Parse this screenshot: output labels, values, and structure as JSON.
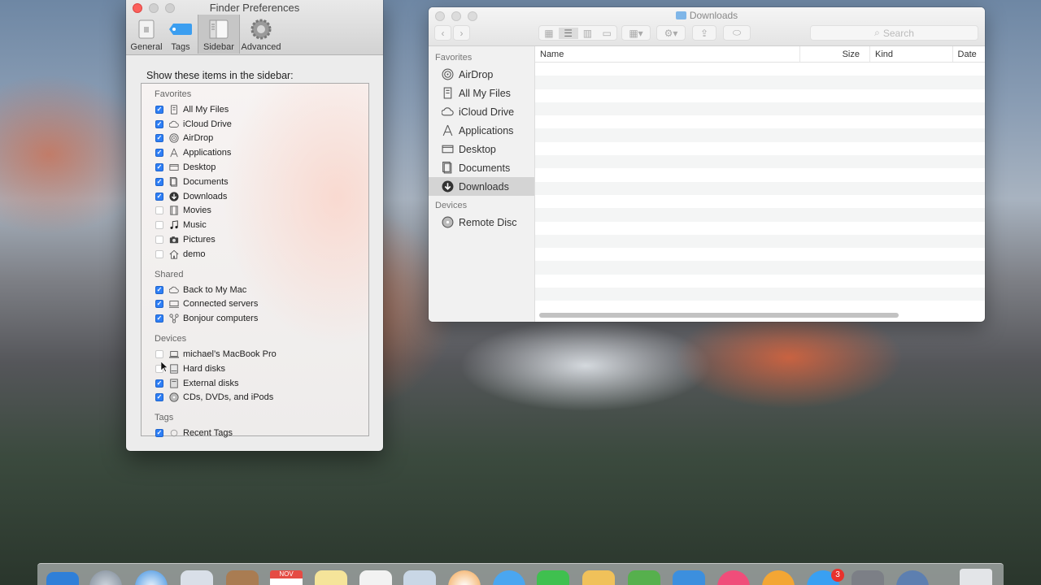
{
  "prefs": {
    "title": "Finder Preferences",
    "tabs": [
      {
        "label": "General",
        "icon": "general-icon"
      },
      {
        "label": "Tags",
        "icon": "tag-icon"
      },
      {
        "label": "Sidebar",
        "icon": "sidebar-icon",
        "active": true
      },
      {
        "label": "Advanced",
        "icon": "gear-icon"
      }
    ],
    "heading": "Show these items in the sidebar:",
    "sections": {
      "favorites": {
        "title": "Favorites",
        "items": [
          {
            "label": "All My Files",
            "checked": true,
            "icon": "all-files-icon"
          },
          {
            "label": "iCloud Drive",
            "checked": true,
            "icon": "cloud-icon"
          },
          {
            "label": "AirDrop",
            "checked": true,
            "icon": "airdrop-icon"
          },
          {
            "label": "Applications",
            "checked": true,
            "icon": "applications-icon"
          },
          {
            "label": "Desktop",
            "checked": true,
            "icon": "desktop-icon"
          },
          {
            "label": "Documents",
            "checked": true,
            "icon": "documents-icon"
          },
          {
            "label": "Downloads",
            "checked": true,
            "icon": "downloads-icon"
          },
          {
            "label": "Movies",
            "checked": false,
            "icon": "movies-icon"
          },
          {
            "label": "Music",
            "checked": false,
            "icon": "music-icon"
          },
          {
            "label": "Pictures",
            "checked": false,
            "icon": "camera-icon"
          },
          {
            "label": "demo",
            "checked": false,
            "icon": "home-icon"
          }
        ]
      },
      "shared": {
        "title": "Shared",
        "items": [
          {
            "label": "Back to My Mac",
            "checked": true,
            "icon": "cloud-icon"
          },
          {
            "label": "Connected servers",
            "checked": true,
            "icon": "server-icon"
          },
          {
            "label": "Bonjour computers",
            "checked": true,
            "icon": "bonjour-icon"
          }
        ]
      },
      "devices": {
        "title": "Devices",
        "items": [
          {
            "label": "michael’s MacBook Pro",
            "checked": false,
            "icon": "laptop-icon"
          },
          {
            "label": "Hard disks",
            "checked": false,
            "icon": "hard-disk-icon"
          },
          {
            "label": "External disks",
            "checked": true,
            "icon": "external-disk-icon"
          },
          {
            "label": "CDs, DVDs, and iPods",
            "checked": true,
            "icon": "disc-icon"
          }
        ]
      },
      "tags": {
        "title": "Tags",
        "items": [
          {
            "label": "Recent Tags",
            "checked": true,
            "icon": "tag-circle-icon"
          }
        ]
      }
    }
  },
  "finder": {
    "title": "Downloads",
    "search_placeholder": "Search",
    "sidebar": {
      "favorites_title": "Favorites",
      "favorites": [
        {
          "label": "AirDrop",
          "icon": "airdrop-icon"
        },
        {
          "label": "All My Files",
          "icon": "all-files-icon"
        },
        {
          "label": "iCloud Drive",
          "icon": "cloud-icon"
        },
        {
          "label": "Applications",
          "icon": "applications-icon"
        },
        {
          "label": "Desktop",
          "icon": "desktop-icon"
        },
        {
          "label": "Documents",
          "icon": "documents-icon"
        },
        {
          "label": "Downloads",
          "icon": "downloads-icon",
          "selected": true
        }
      ],
      "devices_title": "Devices",
      "devices": [
        {
          "label": "Remote Disc",
          "icon": "disc-icon"
        }
      ]
    },
    "columns": [
      "Name",
      "Size",
      "Kind",
      "Date"
    ]
  },
  "dock": {
    "badge_count": "3",
    "calendar_month": "NOV"
  }
}
